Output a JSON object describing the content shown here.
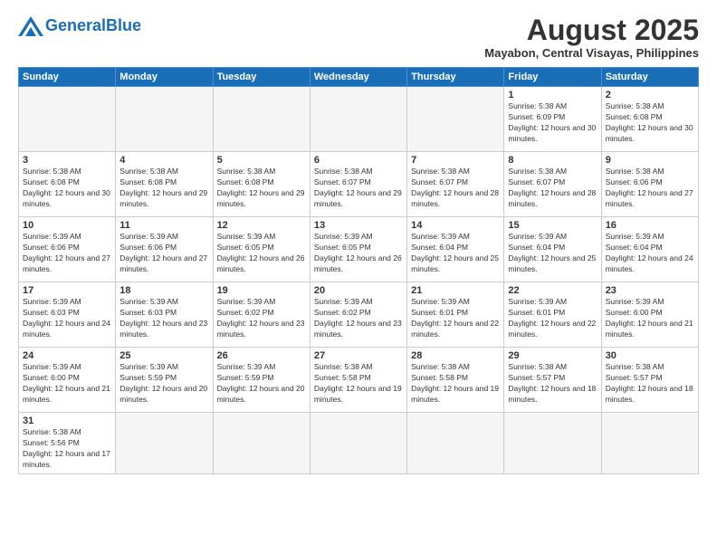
{
  "header": {
    "logo_text_general": "General",
    "logo_text_blue": "Blue",
    "month_year": "August 2025",
    "location": "Mayabon, Central Visayas, Philippines"
  },
  "days_of_week": [
    "Sunday",
    "Monday",
    "Tuesday",
    "Wednesday",
    "Thursday",
    "Friday",
    "Saturday"
  ],
  "weeks": [
    [
      {
        "num": "",
        "info": ""
      },
      {
        "num": "",
        "info": ""
      },
      {
        "num": "",
        "info": ""
      },
      {
        "num": "",
        "info": ""
      },
      {
        "num": "",
        "info": ""
      },
      {
        "num": "1",
        "info": "Sunrise: 5:38 AM\nSunset: 6:09 PM\nDaylight: 12 hours and 30 minutes."
      },
      {
        "num": "2",
        "info": "Sunrise: 5:38 AM\nSunset: 6:08 PM\nDaylight: 12 hours and 30 minutes."
      }
    ],
    [
      {
        "num": "3",
        "info": "Sunrise: 5:38 AM\nSunset: 6:08 PM\nDaylight: 12 hours and 30 minutes."
      },
      {
        "num": "4",
        "info": "Sunrise: 5:38 AM\nSunset: 6:08 PM\nDaylight: 12 hours and 29 minutes."
      },
      {
        "num": "5",
        "info": "Sunrise: 5:38 AM\nSunset: 6:08 PM\nDaylight: 12 hours and 29 minutes."
      },
      {
        "num": "6",
        "info": "Sunrise: 5:38 AM\nSunset: 6:07 PM\nDaylight: 12 hours and 29 minutes."
      },
      {
        "num": "7",
        "info": "Sunrise: 5:38 AM\nSunset: 6:07 PM\nDaylight: 12 hours and 28 minutes."
      },
      {
        "num": "8",
        "info": "Sunrise: 5:38 AM\nSunset: 6:07 PM\nDaylight: 12 hours and 28 minutes."
      },
      {
        "num": "9",
        "info": "Sunrise: 5:38 AM\nSunset: 6:06 PM\nDaylight: 12 hours and 27 minutes."
      }
    ],
    [
      {
        "num": "10",
        "info": "Sunrise: 5:39 AM\nSunset: 6:06 PM\nDaylight: 12 hours and 27 minutes."
      },
      {
        "num": "11",
        "info": "Sunrise: 5:39 AM\nSunset: 6:06 PM\nDaylight: 12 hours and 27 minutes."
      },
      {
        "num": "12",
        "info": "Sunrise: 5:39 AM\nSunset: 6:05 PM\nDaylight: 12 hours and 26 minutes."
      },
      {
        "num": "13",
        "info": "Sunrise: 5:39 AM\nSunset: 6:05 PM\nDaylight: 12 hours and 26 minutes."
      },
      {
        "num": "14",
        "info": "Sunrise: 5:39 AM\nSunset: 6:04 PM\nDaylight: 12 hours and 25 minutes."
      },
      {
        "num": "15",
        "info": "Sunrise: 5:39 AM\nSunset: 6:04 PM\nDaylight: 12 hours and 25 minutes."
      },
      {
        "num": "16",
        "info": "Sunrise: 5:39 AM\nSunset: 6:04 PM\nDaylight: 12 hours and 24 minutes."
      }
    ],
    [
      {
        "num": "17",
        "info": "Sunrise: 5:39 AM\nSunset: 6:03 PM\nDaylight: 12 hours and 24 minutes."
      },
      {
        "num": "18",
        "info": "Sunrise: 5:39 AM\nSunset: 6:03 PM\nDaylight: 12 hours and 23 minutes."
      },
      {
        "num": "19",
        "info": "Sunrise: 5:39 AM\nSunset: 6:02 PM\nDaylight: 12 hours and 23 minutes."
      },
      {
        "num": "20",
        "info": "Sunrise: 5:39 AM\nSunset: 6:02 PM\nDaylight: 12 hours and 23 minutes."
      },
      {
        "num": "21",
        "info": "Sunrise: 5:39 AM\nSunset: 6:01 PM\nDaylight: 12 hours and 22 minutes."
      },
      {
        "num": "22",
        "info": "Sunrise: 5:39 AM\nSunset: 6:01 PM\nDaylight: 12 hours and 22 minutes."
      },
      {
        "num": "23",
        "info": "Sunrise: 5:39 AM\nSunset: 6:00 PM\nDaylight: 12 hours and 21 minutes."
      }
    ],
    [
      {
        "num": "24",
        "info": "Sunrise: 5:39 AM\nSunset: 6:00 PM\nDaylight: 12 hours and 21 minutes."
      },
      {
        "num": "25",
        "info": "Sunrise: 5:39 AM\nSunset: 5:59 PM\nDaylight: 12 hours and 20 minutes."
      },
      {
        "num": "26",
        "info": "Sunrise: 5:39 AM\nSunset: 5:59 PM\nDaylight: 12 hours and 20 minutes."
      },
      {
        "num": "27",
        "info": "Sunrise: 5:38 AM\nSunset: 5:58 PM\nDaylight: 12 hours and 19 minutes."
      },
      {
        "num": "28",
        "info": "Sunrise: 5:38 AM\nSunset: 5:58 PM\nDaylight: 12 hours and 19 minutes."
      },
      {
        "num": "29",
        "info": "Sunrise: 5:38 AM\nSunset: 5:57 PM\nDaylight: 12 hours and 18 minutes."
      },
      {
        "num": "30",
        "info": "Sunrise: 5:38 AM\nSunset: 5:57 PM\nDaylight: 12 hours and 18 minutes."
      }
    ],
    [
      {
        "num": "31",
        "info": "Sunrise: 5:38 AM\nSunset: 5:56 PM\nDaylight: 12 hours and 17 minutes."
      },
      {
        "num": "",
        "info": ""
      },
      {
        "num": "",
        "info": ""
      },
      {
        "num": "",
        "info": ""
      },
      {
        "num": "",
        "info": ""
      },
      {
        "num": "",
        "info": ""
      },
      {
        "num": "",
        "info": ""
      }
    ]
  ]
}
